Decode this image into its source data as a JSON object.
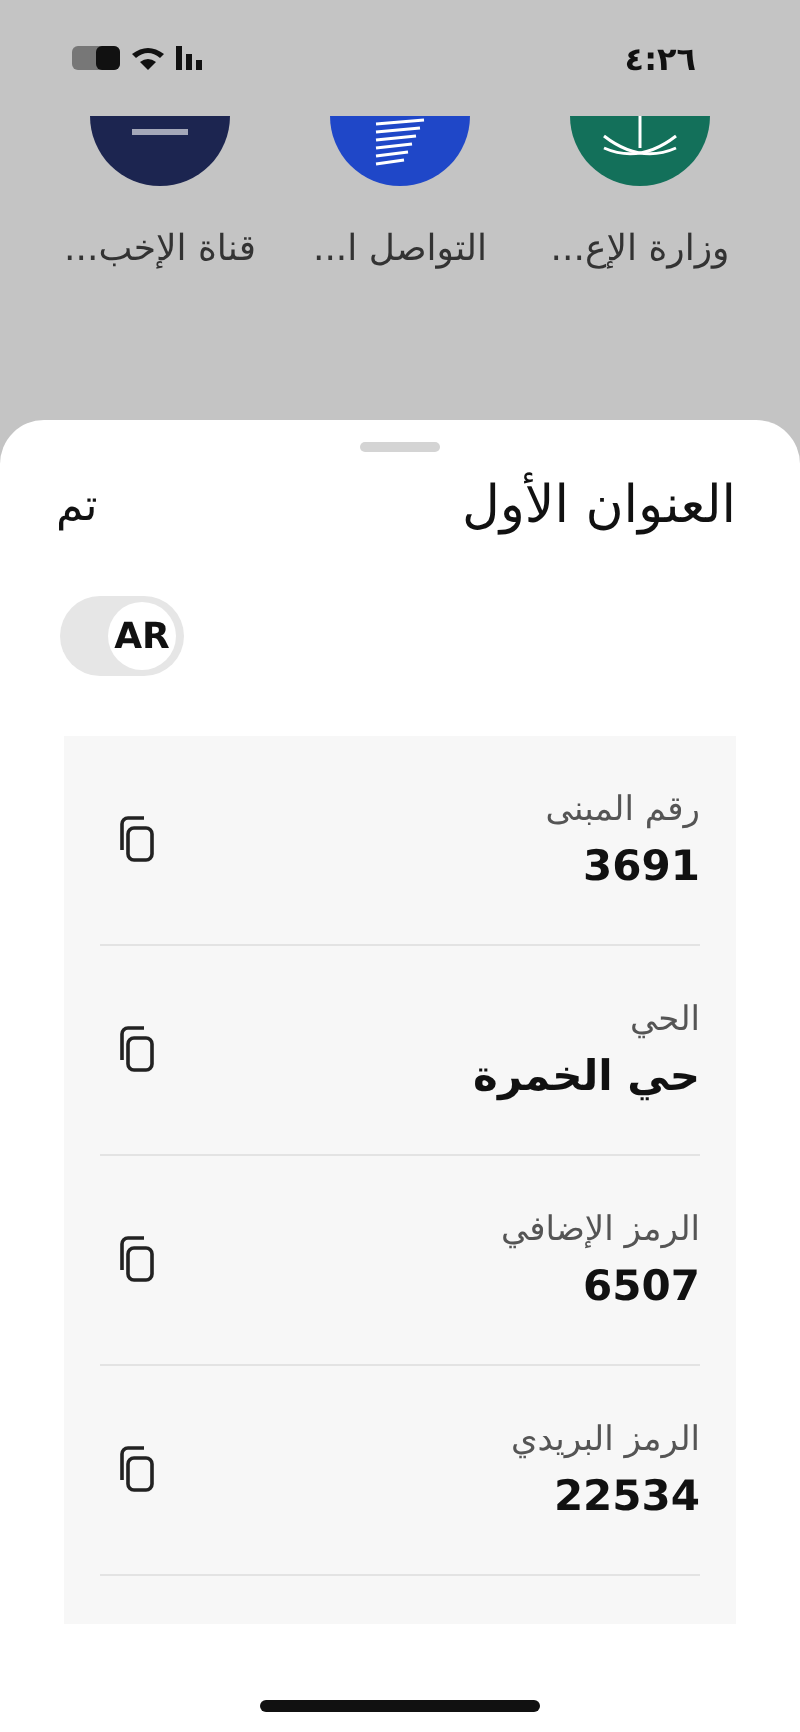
{
  "status_bar": {
    "time": "٤:٢٦"
  },
  "apps": [
    {
      "label": "وزارة الإع...",
      "color": "#13705a",
      "kind": "emblem"
    },
    {
      "label": "التواصل ا...",
      "color": "#1f47c8",
      "kind": "wing"
    },
    {
      "label": "قناة الإخب...",
      "color": "#1c2550",
      "kind": "news"
    }
  ],
  "sheet": {
    "title": "العنوان الأول",
    "done": "تم",
    "language": {
      "label": "AR"
    },
    "fields": [
      {
        "label": "رقم المبنى",
        "value": "3691"
      },
      {
        "label": "الحي",
        "value": "حي الخمرة"
      },
      {
        "label": "الرمز الإضافي",
        "value": "6507"
      },
      {
        "label": "الرمز البريدي",
        "value": "22534"
      }
    ]
  }
}
